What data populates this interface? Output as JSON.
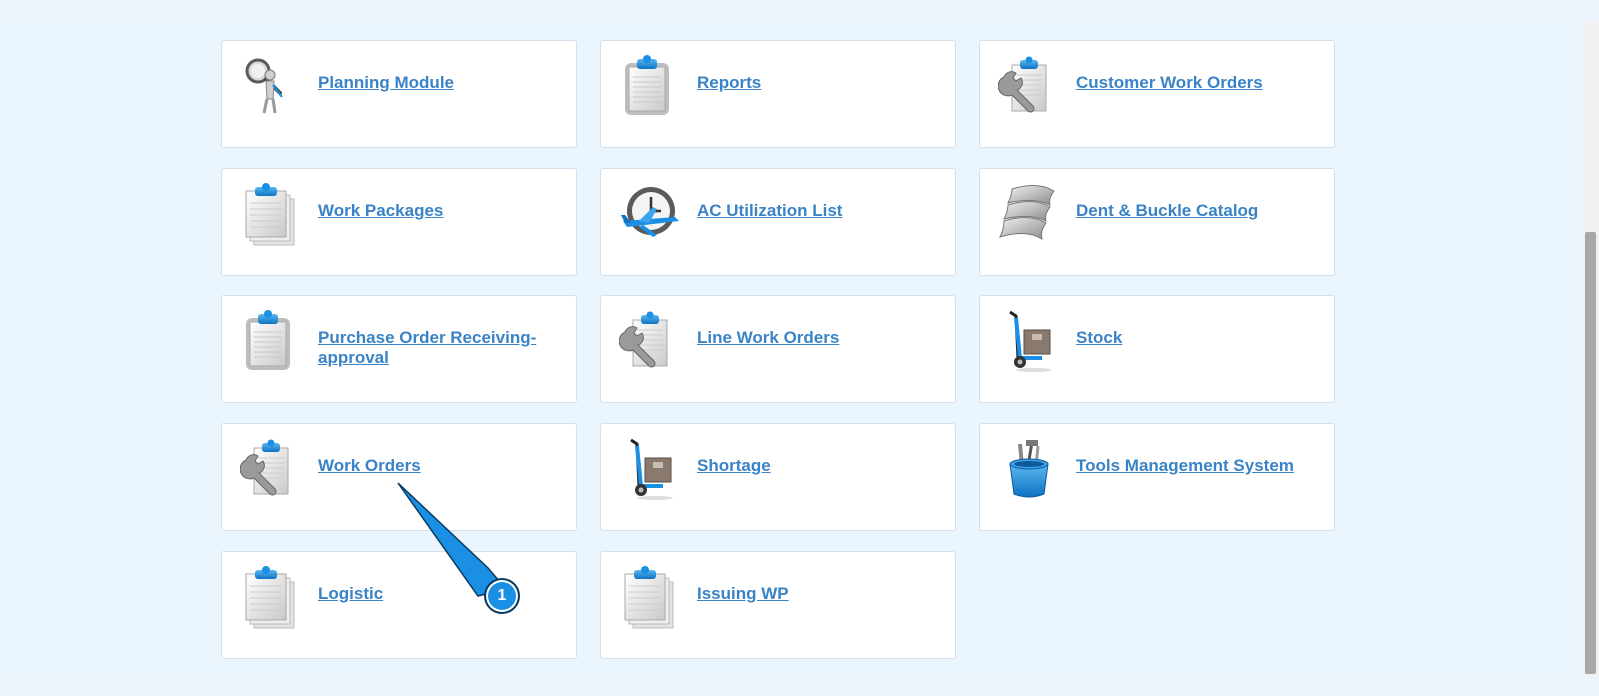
{
  "tiles": [
    {
      "label": "Planning Module",
      "icon": "magnifier-figure-icon"
    },
    {
      "label": "Reports",
      "icon": "clipboard-icon"
    },
    {
      "label": "Customer Work Orders",
      "icon": "clipboard-wrench-icon"
    },
    {
      "label": "Work Packages",
      "icon": "clipboard-stack-icon"
    },
    {
      "label": "AC Utilization List",
      "icon": "clock-airplane-icon"
    },
    {
      "label": "Dent & Buckle Catalog",
      "icon": "metal-panels-icon"
    },
    {
      "label": "Purchase Order Receiving-approval",
      "icon": "clipboard-icon"
    },
    {
      "label": "Line Work Orders",
      "icon": "clipboard-wrench-icon"
    },
    {
      "label": "Stock",
      "icon": "hand-truck-icon"
    },
    {
      "label": "Work Orders",
      "icon": "clipboard-wrench-icon"
    },
    {
      "label": "Shortage",
      "icon": "hand-truck-icon"
    },
    {
      "label": "Tools Management System",
      "icon": "tool-bucket-icon"
    },
    {
      "label": "Logistic",
      "icon": "clipboard-stack-icon"
    },
    {
      "label": "Issuing WP",
      "icon": "clipboard-stack-icon"
    }
  ],
  "callout": {
    "number": "1",
    "target": "Work Orders",
    "color": "#1a8fe3"
  },
  "colors": {
    "link": "#3a83c6",
    "background": "#eaf5fe",
    "tile_border": "#d6e0ea",
    "accent": "#1a8fe3"
  }
}
